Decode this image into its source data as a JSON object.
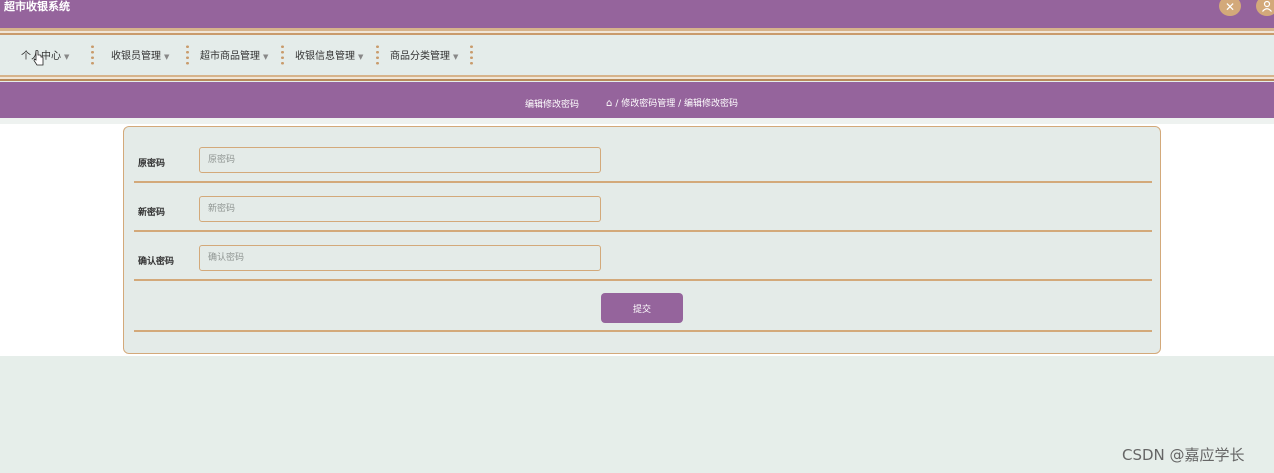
{
  "app": {
    "title": "超市收银系统"
  },
  "nav": {
    "items": [
      {
        "label": "个人中心"
      },
      {
        "label": "收银员管理"
      },
      {
        "label": "超市商品管理"
      },
      {
        "label": "收银信息管理"
      },
      {
        "label": "商品分类管理"
      }
    ]
  },
  "page": {
    "title": "编辑修改密码",
    "breadcrumb": "/ 修改密码管理 / 编辑修改密码"
  },
  "form": {
    "old_password": {
      "label": "原密码",
      "placeholder": "原密码",
      "value": ""
    },
    "new_password": {
      "label": "新密码",
      "placeholder": "新密码",
      "value": ""
    },
    "confirm_password": {
      "label": "确认密码",
      "placeholder": "确认密码",
      "value": ""
    },
    "submit_label": "提交"
  },
  "watermark": "CSDN @嘉应学长",
  "colors": {
    "primary": "#95649c",
    "accent": "#d3a97a",
    "background": "#e6eeea"
  },
  "icons": {
    "fullscreen": "expand-icon",
    "user": "user-icon",
    "home": "home-icon"
  }
}
